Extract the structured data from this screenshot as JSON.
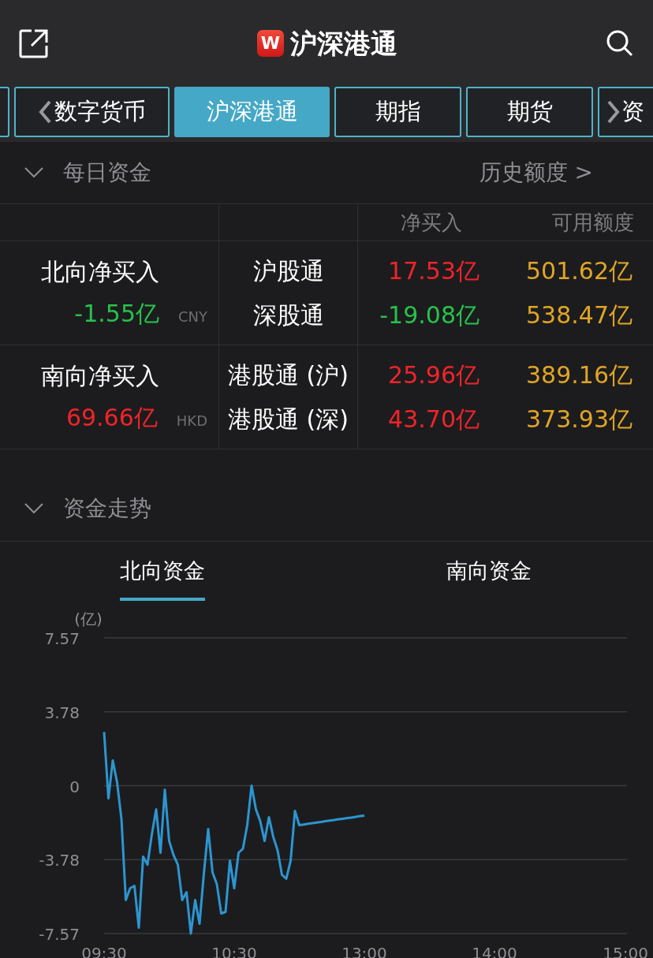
{
  "header": {
    "logo_text": "W",
    "title": "沪深港通"
  },
  "tabs": [
    {
      "label": "数字货币",
      "kind": "prev",
      "selected": false
    },
    {
      "label": "沪深港通",
      "kind": "plain",
      "selected": true
    },
    {
      "label": "期指",
      "kind": "plain",
      "selected": false
    },
    {
      "label": "期货",
      "kind": "plain",
      "selected": false
    },
    {
      "label": "资",
      "kind": "next",
      "selected": false
    }
  ],
  "daily_funds": {
    "title": "每日资金",
    "expanded": true,
    "link": "历史额度 >",
    "columns": [
      "净买入",
      "可用额度"
    ],
    "groups": [
      {
        "label": "北向净买入",
        "total": "-1.55亿",
        "color": "#27c24c",
        "currency": "CNY",
        "rows": [
          {
            "name": "沪股通",
            "net": "17.53亿",
            "color": "#f0242a",
            "quota": "501.62亿"
          },
          {
            "name": "深股通",
            "net": "-19.08亿",
            "color": "#27c24c",
            "quota": "538.47亿"
          }
        ]
      },
      {
        "label": "南向净买入",
        "total": "69.66亿",
        "color": "#f0242a",
        "currency": "HKD",
        "rows": [
          {
            "name": "港股通 (沪)",
            "net": "25.96亿",
            "color": "#f0242a",
            "quota": "389.16亿"
          },
          {
            "name": "港股通 (深)",
            "net": "43.70亿",
            "color": "#f0242a",
            "quota": "373.93亿"
          }
        ]
      }
    ]
  },
  "fund_trend": {
    "title": "资金走势",
    "expanded": true,
    "subtabs": [
      {
        "label": "北向资金",
        "selected": true
      },
      {
        "label": "南向资金",
        "selected": false
      }
    ],
    "chart_data": {
      "type": "line",
      "grid": true,
      "ylabel": "(亿)",
      "ylim": [
        -7.57,
        7.57
      ],
      "categories": [
        "09:30",
        null,
        null,
        null,
        null,
        null,
        null,
        null,
        null,
        null,
        null,
        null,
        null,
        null,
        null,
        null,
        null,
        null,
        null,
        null,
        null,
        null,
        null,
        null,
        null,
        null,
        null,
        null,
        null,
        null,
        "10:30",
        null,
        null,
        null,
        null,
        null,
        null,
        null,
        null,
        null,
        null,
        null,
        null,
        null,
        null,
        null,
        null,
        null,
        null,
        null,
        null,
        null,
        null,
        null,
        null,
        null,
        null,
        null,
        null,
        null,
        "13:00",
        null,
        null,
        null,
        null,
        null,
        null,
        null,
        null,
        null,
        null,
        null,
        null,
        null,
        null,
        null,
        null,
        null,
        null,
        null,
        null,
        null,
        null,
        null,
        null,
        null,
        null,
        null,
        null,
        null,
        "14:00",
        null,
        null,
        null,
        null,
        null,
        null,
        null,
        null,
        null,
        null,
        null,
        null,
        null,
        null,
        null,
        null,
        null,
        null,
        null,
        null,
        null,
        null,
        null,
        null,
        null,
        null,
        null,
        null,
        null,
        "15:00"
      ],
      "yticks": [
        {
          "value": 7.57,
          "label": "7.57"
        },
        {
          "value": 3.78,
          "label": "3.78"
        },
        {
          "value": 0,
          "label": "0"
        },
        {
          "value": -3.78,
          "label": "-3.78"
        },
        {
          "value": -7.57,
          "label": "-7.57"
        }
      ],
      "series": [
        {
          "color": "#2d95d0",
          "values": [
            2.75,
            -0.65,
            1.29,
            0.16,
            -1.7,
            -5.85,
            -5.25,
            -5.13,
            -7.27,
            -3.63,
            -4.04,
            -2.5,
            -1.21,
            -3.43,
            -0.2,
            -2.83,
            -3.55,
            -4.04,
            -5.85,
            -5.45,
            -7.57,
            -5.85,
            -7.07,
            -4.5,
            -2.22,
            -4.44,
            -5.05,
            -6.54,
            -6.46,
            -3.84,
            -5.25,
            -3.43,
            -3.23,
            -2.02,
            0,
            -1.21,
            -1.82,
            -2.83,
            -1.61,
            -2.62,
            -3.31,
            -4.56,
            -4.76,
            -3.84,
            -1.29,
            -2.02,
            -1.99,
            -1.95,
            -1.92,
            -1.89,
            -1.86,
            -1.82,
            -1.79,
            -1.76,
            -1.72,
            -1.69,
            -1.66,
            -1.63,
            -1.6,
            -1.56,
            -1.53,
            null,
            null,
            null,
            null,
            null,
            null,
            null,
            null,
            null,
            null,
            null,
            null,
            null,
            null,
            null,
            null,
            null,
            null,
            null,
            null,
            null,
            null,
            null,
            null,
            null,
            null,
            null,
            null,
            null,
            null,
            null,
            null,
            null,
            null,
            null,
            null,
            null,
            null,
            null,
            null,
            null,
            null,
            null,
            null,
            null,
            null,
            null,
            null,
            null,
            null,
            null,
            null,
            null,
            null,
            null,
            null,
            null,
            null,
            null,
            null
          ]
        }
      ]
    }
  }
}
